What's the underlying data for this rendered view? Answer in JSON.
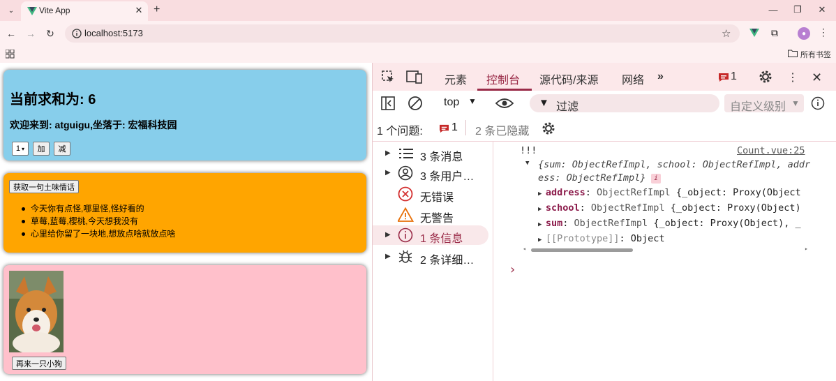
{
  "browser": {
    "tab_title": "Vite App",
    "new_tab_label": "+",
    "url": "localhost:5173",
    "bookmarks_all_label": "所有书签",
    "window_controls": [
      "minimize-icon",
      "maximize-icon",
      "close-icon"
    ],
    "accent": "#9a2b48"
  },
  "page": {
    "sum_heading": "当前求和为: 6",
    "welcome": "欢迎来到: atguigu,坐落于: 宏福科技园",
    "step_value": "1",
    "add_label": "加",
    "sub_label": "减",
    "fetch_label": "获取一句土味情话",
    "talks": [
      "今天你有点怪,哪里怪,怪好看的",
      "草莓,蓝莓,樱桃,今天想我没有",
      "心里给你留了一块地,想放点啥就放点啥"
    ],
    "more_dog_label": "再来一只小狗",
    "colors": {
      "count_card": "#87ceeb",
      "talk_card": "#ffa500",
      "dog_card": "#ffc0cb"
    }
  },
  "devtools": {
    "tabs": [
      "元素",
      "控制台",
      "源代码/来源",
      "网络"
    ],
    "active_tab": "控制台",
    "issue_badge_count": "1",
    "filter": {
      "context": "top",
      "filter_placeholder": "过滤",
      "level_label": "自定义级别"
    },
    "issues_bar": {
      "issues_label": "1 个问题:",
      "issue_count": "1",
      "hidden_label": "2 条已隐藏"
    },
    "sidebar": [
      {
        "label": "3 条消息",
        "icon": "list-icon",
        "expandable": true
      },
      {
        "label": "3 条用户…",
        "icon": "user-icon",
        "expandable": true
      },
      {
        "label": "无错误",
        "icon": "error-icon",
        "expandable": false
      },
      {
        "label": "无警告",
        "icon": "warning-icon",
        "expandable": false
      },
      {
        "label": "1 条信息",
        "icon": "info-icon",
        "expandable": true
      },
      {
        "label": "2 条详细…",
        "icon": "bug-icon",
        "expandable": true
      }
    ],
    "console": {
      "log_text": "!!!",
      "source_link": "Count.vue:25",
      "object_summary_1": "{sum: ObjectRefImpl, school: ObjectRefImpl, addr",
      "object_summary_2": "ess: ObjectRefImpl}",
      "info_badge": "i",
      "props": [
        {
          "key": "address",
          "type": "ObjectRefImpl",
          "preview": "{_object: Proxy(Object"
        },
        {
          "key": "school",
          "type": "ObjectRefImpl",
          "preview": "{_object: Proxy(Object)"
        },
        {
          "key": "sum",
          "type": "ObjectRefImpl",
          "preview": "{_object: Proxy(Object), _"
        }
      ],
      "prototype_key": "[[Prototype]]",
      "prototype_value": "Object",
      "prompt": "›"
    }
  }
}
